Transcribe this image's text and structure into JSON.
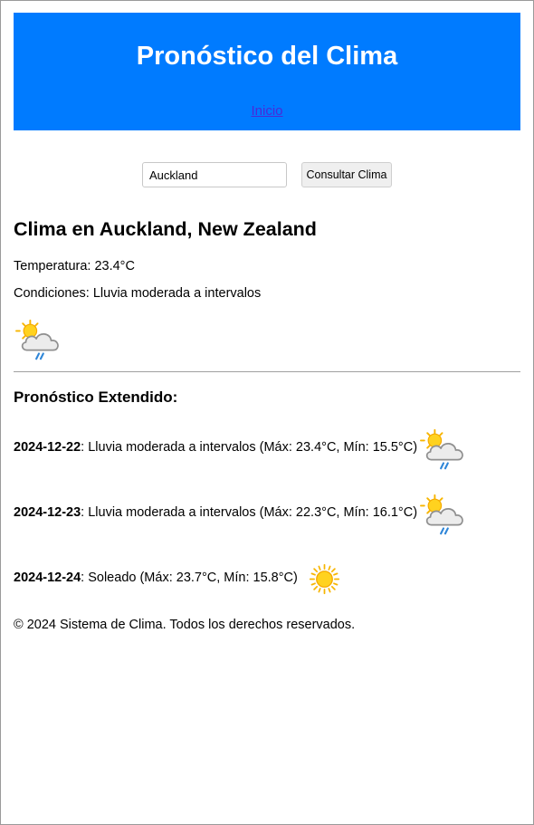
{
  "header": {
    "title": "Pronóstico del Clima",
    "nav_link": "Inicio"
  },
  "search": {
    "value": "Auckland",
    "button_label": "Consultar Clima"
  },
  "current": {
    "heading": "Clima en Auckland, New Zealand",
    "temperature_text": "Temperatura: 23.4°C",
    "conditions_text": "Condiciones: Lluvia moderada a intervalos",
    "icon": "patchy-rain-icon"
  },
  "forecast": {
    "heading": "Pronóstico Extendido:",
    "days": [
      {
        "date": "2024-12-22",
        "text": ": Lluvia moderada a intervalos (Máx: 23.4°C, Mín: 15.5°C)",
        "icon": "patchy-rain-icon"
      },
      {
        "date": "2024-12-23",
        "text": ": Lluvia moderada a intervalos (Máx: 22.3°C, Mín: 16.1°C)",
        "icon": "patchy-rain-icon"
      },
      {
        "date": "2024-12-24",
        "text": ": Soleado (Máx: 23.7°C, Mín: 15.8°C)",
        "icon": "sunny-icon"
      }
    ]
  },
  "footer": {
    "text": "© 2024 Sistema de Clima. Todos los derechos reservados."
  }
}
